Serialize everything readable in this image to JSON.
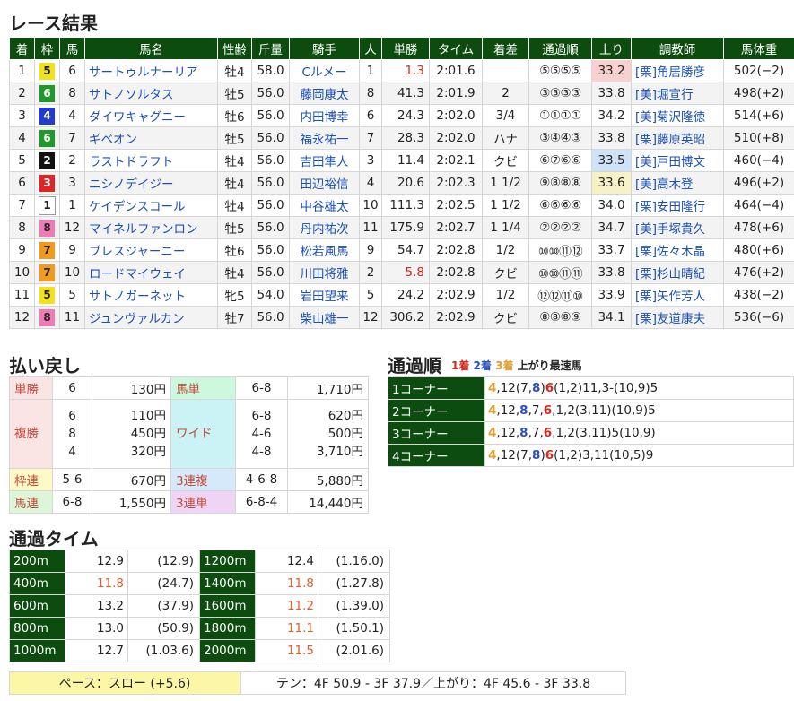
{
  "sections": {
    "results": "レース結果",
    "payout": "払い戻し",
    "corners": "通過順",
    "laps": "通過タイム"
  },
  "results_headers": [
    "着",
    "枠",
    "馬",
    "馬名",
    "性齢",
    "斤量",
    "騎手",
    "人",
    "単勝",
    "タイム",
    "着差",
    "通過順",
    "上り",
    "調教師",
    "馬体重"
  ],
  "frame_colors": {
    "1": {
      "bg": "#ffffff",
      "fg": "#222222"
    },
    "2": {
      "bg": "#111111",
      "fg": "#ffffff"
    },
    "3": {
      "bg": "#e02424",
      "fg": "#ffffff"
    },
    "4": {
      "bg": "#1f3ad6",
      "fg": "#ffffff"
    },
    "5": {
      "bg": "#f2e21b",
      "fg": "#222222"
    },
    "6": {
      "bg": "#1f9a2a",
      "fg": "#ffffff"
    },
    "7": {
      "bg": "#f29a1e",
      "fg": "#222222"
    },
    "8": {
      "bg": "#f07ab4",
      "fg": "#222222"
    }
  },
  "results": [
    {
      "pos": "1",
      "frame": "5",
      "num": "6",
      "horse": "サートゥルナーリア",
      "sexage": "牡4",
      "weight": "58.0",
      "jockey": "Cルメー",
      "pop": "1",
      "odds": "1.3",
      "odds_hl": true,
      "time": "2:01.6",
      "margin": "",
      "passing": "⑤⑤⑤⑤",
      "last3f": "33.2",
      "up_rank": 1,
      "trainer": "[栗]角居勝彦",
      "body": "502(−2)"
    },
    {
      "pos": "2",
      "frame": "6",
      "num": "8",
      "horse": "サトノソルタス",
      "sexage": "牡5",
      "weight": "56.0",
      "jockey": "藤岡康太",
      "pop": "8",
      "odds": "41.3",
      "odds_hl": false,
      "time": "2:01.9",
      "margin": "2",
      "passing": "③③③③",
      "last3f": "33.8",
      "up_rank": 0,
      "trainer": "[美]堀宣行",
      "body": "498(+2)"
    },
    {
      "pos": "3",
      "frame": "4",
      "num": "4",
      "horse": "ダイワキャグニー",
      "sexage": "牡6",
      "weight": "56.0",
      "jockey": "内田博幸",
      "pop": "6",
      "odds": "24.3",
      "odds_hl": false,
      "time": "2:02.0",
      "margin": "3/4",
      "passing": "①①①①",
      "last3f": "34.2",
      "up_rank": 0,
      "trainer": "[美]菊沢隆徳",
      "body": "514(+6)"
    },
    {
      "pos": "4",
      "frame": "6",
      "num": "7",
      "horse": "ギベオン",
      "sexage": "牡5",
      "weight": "56.0",
      "jockey": "福永祐一",
      "pop": "7",
      "odds": "28.3",
      "odds_hl": false,
      "time": "2:02.0",
      "margin": "ハナ",
      "passing": "③④④③",
      "last3f": "33.8",
      "up_rank": 0,
      "trainer": "[栗]藤原英昭",
      "body": "510(+8)"
    },
    {
      "pos": "5",
      "frame": "2",
      "num": "2",
      "horse": "ラストドラフト",
      "sexage": "牡4",
      "weight": "56.0",
      "jockey": "吉田隼人",
      "pop": "3",
      "odds": "11.4",
      "odds_hl": false,
      "time": "2:02.1",
      "margin": "クビ",
      "passing": "⑥⑦⑥⑥",
      "last3f": "33.5",
      "up_rank": 2,
      "trainer": "[美]戸田博文",
      "body": "460(−4)"
    },
    {
      "pos": "6",
      "frame": "3",
      "num": "3",
      "horse": "ニシノデイジー",
      "sexage": "牡4",
      "weight": "56.0",
      "jockey": "田辺裕信",
      "pop": "4",
      "odds": "20.6",
      "odds_hl": false,
      "time": "2:02.3",
      "margin": "1 1/2",
      "passing": "⑨⑧⑧⑧",
      "last3f": "33.6",
      "up_rank": 3,
      "trainer": "[美]高木登",
      "body": "496(+2)"
    },
    {
      "pos": "7",
      "frame": "1",
      "num": "1",
      "horse": "ケイデンスコール",
      "sexage": "牡4",
      "weight": "56.0",
      "jockey": "中谷雄太",
      "pop": "10",
      "odds": "111.3",
      "odds_hl": false,
      "time": "2:02.5",
      "margin": "1 1/2",
      "passing": "⑥⑥⑥⑥",
      "last3f": "34.0",
      "up_rank": 0,
      "trainer": "[栗]安田隆行",
      "body": "464(−4)"
    },
    {
      "pos": "8",
      "frame": "8",
      "num": "12",
      "horse": "マイネルファンロン",
      "sexage": "牡5",
      "weight": "56.0",
      "jockey": "丹内祐次",
      "pop": "11",
      "odds": "175.9",
      "odds_hl": false,
      "time": "2:02.7",
      "margin": "1 1/4",
      "passing": "②②②②",
      "last3f": "34.7",
      "up_rank": 0,
      "trainer": "[美]手塚貴久",
      "body": "478(+6)"
    },
    {
      "pos": "9",
      "frame": "7",
      "num": "9",
      "horse": "ブレスジャーニー",
      "sexage": "牡6",
      "weight": "56.0",
      "jockey": "松若風馬",
      "pop": "9",
      "odds": "54.7",
      "odds_hl": false,
      "time": "2:02.8",
      "margin": "1/2",
      "passing": "⑩⑩⑪⑫",
      "last3f": "33.7",
      "up_rank": 0,
      "trainer": "[栗]佐々木晶",
      "body": "480(+6)"
    },
    {
      "pos": "10",
      "frame": "7",
      "num": "10",
      "horse": "ロードマイウェイ",
      "sexage": "牡4",
      "weight": "56.0",
      "jockey": "川田将雅",
      "pop": "2",
      "odds": "5.8",
      "odds_hl": true,
      "time": "2:02.8",
      "margin": "クビ",
      "passing": "⑩⑩⑪⑪",
      "last3f": "33.8",
      "up_rank": 0,
      "trainer": "[栗]杉山晴紀",
      "body": "476(+2)"
    },
    {
      "pos": "11",
      "frame": "5",
      "num": "5",
      "horse": "サトノガーネット",
      "sexage": "牝5",
      "weight": "54.0",
      "jockey": "岩田望来",
      "pop": "5",
      "odds": "24.2",
      "odds_hl": false,
      "time": "2:02.9",
      "margin": "1/2",
      "passing": "⑫⑫⑪⑩",
      "last3f": "33.9",
      "up_rank": 0,
      "trainer": "[栗]矢作芳人",
      "body": "438(−2)"
    },
    {
      "pos": "12",
      "frame": "8",
      "num": "11",
      "horse": "ジュンヴァルカン",
      "sexage": "牡7",
      "weight": "56.0",
      "jockey": "柴山雄一",
      "pop": "12",
      "odds": "306.2",
      "odds_hl": false,
      "time": "2:02.9",
      "margin": "クビ",
      "passing": "⑧⑧⑧⑨",
      "last3f": "34.1",
      "up_rank": 0,
      "trainer": "[栗]友道康夫",
      "body": "536(−6)"
    }
  ],
  "payout": {
    "win": {
      "label": "単勝",
      "combo": "6",
      "amount": "130円"
    },
    "place": {
      "label": "複勝",
      "combos": [
        "6",
        "8",
        "4"
      ],
      "amounts": [
        "110円",
        "450円",
        "320円"
      ]
    },
    "wakuren": {
      "label": "枠連",
      "combo": "5-6",
      "amount": "670円"
    },
    "umaren": {
      "label": "馬連",
      "combo": "6-8",
      "amount": "1,550円"
    },
    "umatan": {
      "label": "馬単",
      "combo": "6-8",
      "amount": "1,710円"
    },
    "wide": {
      "label": "ワイド",
      "combos": [
        "6-8",
        "4-6",
        "4-8"
      ],
      "amounts": [
        "620円",
        "500円",
        "3,710円"
      ]
    },
    "trio": {
      "label": "3連複",
      "combo": "4-6-8",
      "amount": "5,880円"
    },
    "trifecta": {
      "label": "3連単",
      "combo": "6-8-4",
      "amount": "14,440円"
    }
  },
  "corner_legend": {
    "first": "1着",
    "second": "2着",
    "third": "3着",
    "fastest": "上がり最速馬"
  },
  "corners": [
    {
      "label": "1コーナー",
      "parts": [
        [
          "4",
          "p3"
        ],
        [
          ",12(7,",
          ""
        ],
        [
          "8",
          "p2"
        ],
        [
          ")",
          ""
        ],
        [
          "6",
          "p1"
        ],
        [
          "(1,2)11,3-(10,9)5",
          ""
        ]
      ]
    },
    {
      "label": "2コーナー",
      "parts": [
        [
          "4",
          "p3"
        ],
        [
          ",12,",
          ""
        ],
        [
          "8",
          "p2"
        ],
        [
          ",7,",
          ""
        ],
        [
          "6",
          "p1"
        ],
        [
          ",1,2(3,11)(10,9)5",
          ""
        ]
      ]
    },
    {
      "label": "3コーナー",
      "parts": [
        [
          "4",
          "p3"
        ],
        [
          ",12,",
          ""
        ],
        [
          "8",
          "p2"
        ],
        [
          ",7,",
          ""
        ],
        [
          "6",
          "p1"
        ],
        [
          ",1,2(3,11)5(10,9)",
          ""
        ]
      ]
    },
    {
      "label": "4コーナー",
      "parts": [
        [
          "4",
          "p3"
        ],
        [
          ",12(7,",
          ""
        ],
        [
          "8",
          "p2"
        ],
        [
          ")",
          ""
        ],
        [
          "6",
          "p1"
        ],
        [
          "(1,2)3,11(10,5)9",
          ""
        ]
      ]
    }
  ],
  "laps": [
    {
      "dist": "200m",
      "lap": "12.9",
      "cum": "(12.9)",
      "fast": false,
      "dist2": "1200m",
      "lap2": "12.4",
      "cum2": "(1.16.0)",
      "fast2": false
    },
    {
      "dist": "400m",
      "lap": "11.8",
      "cum": "(24.7)",
      "fast": true,
      "dist2": "1400m",
      "lap2": "11.8",
      "cum2": "(1.27.8)",
      "fast2": true
    },
    {
      "dist": "600m",
      "lap": "13.2",
      "cum": "(37.9)",
      "fast": false,
      "dist2": "1600m",
      "lap2": "11.2",
      "cum2": "(1.39.0)",
      "fast2": true
    },
    {
      "dist": "800m",
      "lap": "13.0",
      "cum": "(50.9)",
      "fast": false,
      "dist2": "1800m",
      "lap2": "11.1",
      "cum2": "(1.50.1)",
      "fast2": true
    },
    {
      "dist": "1000m",
      "lap": "12.7",
      "cum": "(1.03.6)",
      "fast": false,
      "dist2": "2000m",
      "lap2": "11.5",
      "cum2": "(2.01.6)",
      "fast2": true
    }
  ],
  "pace": {
    "label": "ペース：スロー (+5.6)",
    "detail": "テン：4F 50.9 - 3F 37.9／上がり：4F 45.6 - 3F 33.8"
  }
}
